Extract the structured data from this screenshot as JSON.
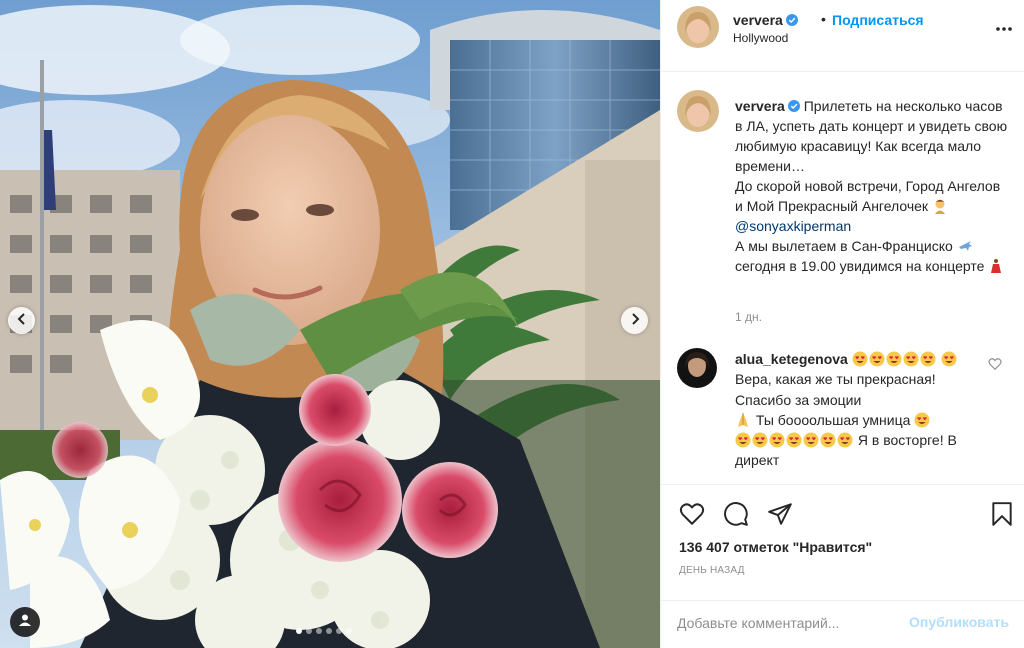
{
  "post": {
    "username": "ververa",
    "follow_label": "Подписаться",
    "separator": "•",
    "location": "Hollywood",
    "more_icon": "more-options-icon",
    "photo": {
      "dots_total": 6,
      "dots_active": 0,
      "prev_icon": "chevron-left-icon",
      "next_icon": "chevron-right-icon",
      "tag_icon": "user-tag-icon"
    }
  },
  "caption": {
    "username": "ververa",
    "line1": "Прилететь на несколько часов в ЛА, успеть дать концерт и увидеть свою любимую красавицу! Как всегда мало времени…",
    "line2": "До скорой новой встречи, Город Ангелов и Мой Прекрасный Ангелочек",
    "emoji1": "person-tipping-hand-emoji",
    "mention": "@sonyaxkiperman",
    "line3": "А мы вылетаем в Сан-Франциско",
    "emoji2": "airplane-emoji",
    "line4": "сегодня в 19.00 увидимся на концерте",
    "emoji3": "dancer-emoji",
    "time": "1 дн."
  },
  "comment": {
    "username": "alua_ketegenova",
    "text1": "Вера, какая же ты прекрасная! Спасибо за эмоции",
    "text2": "Ты боооольшая умница",
    "text3": "Я в восторге! В директ",
    "emoji": "heart-eyes-emoji",
    "like_icon": "heart-outline-icon"
  },
  "actions": {
    "like_icon": "heart-icon",
    "comment_icon": "comment-bubble-icon",
    "share_icon": "paper-plane-icon",
    "save_icon": "bookmark-icon",
    "likes_text": "136 407 отметок \"Нравится\"",
    "date_text": "День назад"
  },
  "add_comment": {
    "placeholder": "Добавьте комментарий...",
    "publish_label": "Опубликовать"
  },
  "colors": {
    "accent": "#0095f6",
    "muted": "#8e8e8e",
    "border": "#efefef",
    "publish_disabled": "#b2dffc",
    "mention": "#00376b"
  }
}
